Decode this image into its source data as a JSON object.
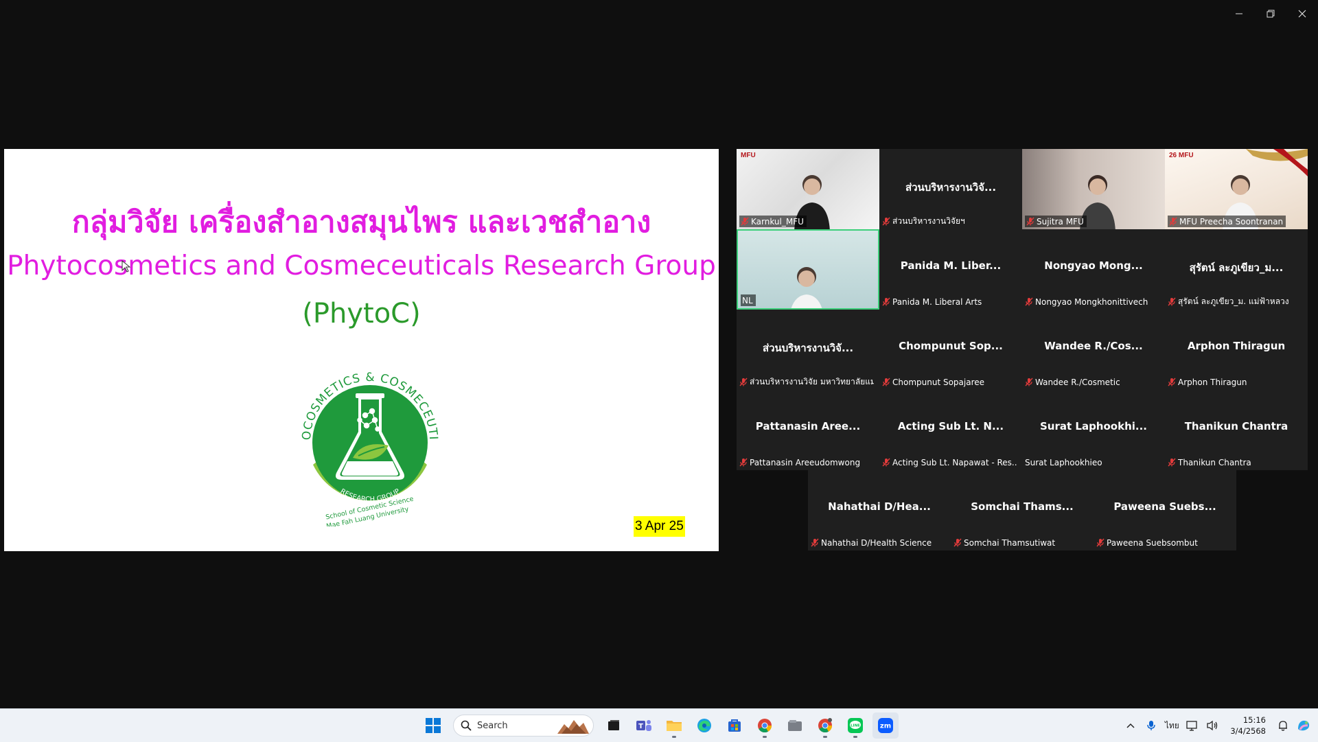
{
  "window": {
    "minimize_label": "–",
    "restore_label": "❐",
    "close_label": "✕"
  },
  "slide": {
    "title_thai": "กลุ่มวิจัย เครื่องสำอางสมุนไพร และเวชสำอาง",
    "title_english": "Phytocosmetics and Cosmeceuticals Research Group",
    "subtitle": "(PhytoC)",
    "logo_text_top": "PHYTOCOSMETICS & COSMECEUTICALS",
    "logo_text_band": "RESEARCH GROUP",
    "logo_text_school": "School of Cosmetic Science",
    "logo_text_university": "Mae Fah Luang University",
    "date_badge": "3 Apr 25",
    "colors": {
      "title": "#e11de0",
      "subtitle": "#2b9a2b",
      "logo_green": "#1f9a3c",
      "logo_light_green": "#8cc63f",
      "date_bg": "#ffff00"
    }
  },
  "participants": [
    {
      "display": "",
      "name": "Karnkul_MFU",
      "muted": true,
      "video": true,
      "overlay_logo": "MFU"
    },
    {
      "display": "ส่วนบริหารงานวิจั...",
      "name": "ส่วนบริหารงานวิจัยฯ",
      "muted": true,
      "video": false
    },
    {
      "display": "",
      "name": "Sujitra MFU",
      "muted": true,
      "video": true
    },
    {
      "display": "",
      "name": "MFU Preecha Soontranan",
      "muted": true,
      "video": true,
      "overlay_logo": "MFU",
      "overlay_number": "26"
    },
    {
      "display": "",
      "name": "NL",
      "muted": false,
      "video": true,
      "active": true
    },
    {
      "display": "Panida M. Liber...",
      "name": "Panida M. Liberal Arts",
      "muted": true,
      "video": false
    },
    {
      "display": "Nongyao Mong...",
      "name": "Nongyao Mongkhonittivech",
      "muted": true,
      "video": false
    },
    {
      "display": "สุรัตน์ ละภูเขียว_ม...",
      "name": "สุรัตน์ ละภูเขียว_ม. แม่ฟ้าหลวง",
      "muted": true,
      "video": false
    },
    {
      "display": "ส่วนบริหารงานวิจั...",
      "name": "ส่วนบริหารงานวิจัย มหาวิทยาลัยแม่...",
      "muted": true,
      "video": false
    },
    {
      "display": "Chompunut Sop...",
      "name": "Chompunut Sopajaree",
      "muted": true,
      "video": false
    },
    {
      "display": "Wandee R./Cos...",
      "name": "Wandee R./Cosmetic",
      "muted": true,
      "video": false
    },
    {
      "display": "Arphon Thiragun",
      "name": "Arphon Thiragun",
      "muted": true,
      "video": false
    },
    {
      "display": "Pattanasin Aree...",
      "name": "Pattanasin Areeudomwong",
      "muted": true,
      "video": false
    },
    {
      "display": "Acting Sub Lt. N...",
      "name": "Acting Sub Lt. Napawat - Res...",
      "muted": true,
      "video": false
    },
    {
      "display": "Surat Laphookhi...",
      "name": "Surat Laphookhieo",
      "muted": false,
      "video": false
    },
    {
      "display": "Thanikun Chantra",
      "name": "Thanikun Chantra",
      "muted": true,
      "video": false
    },
    {
      "display": "Nahathai D/Hea...",
      "name": "Nahathai D/Health Science",
      "muted": true,
      "video": false
    },
    {
      "display": "Somchai Thams...",
      "name": "Somchai Thamsutiwat",
      "muted": true,
      "video": false
    },
    {
      "display": "Paweena Suebs...",
      "name": "Paweena Suebsombut",
      "muted": true,
      "video": false
    }
  ],
  "taskbar": {
    "search_label": "Search",
    "apps": [
      "windows-start",
      "search",
      "task-view",
      "teams",
      "file-explorer",
      "edge",
      "microsoft-store",
      "chrome",
      "files",
      "chrome-profile",
      "line",
      "zoom"
    ],
    "tray": {
      "language": "ไทย",
      "time": "15:16",
      "date": "3/4/2568"
    }
  }
}
